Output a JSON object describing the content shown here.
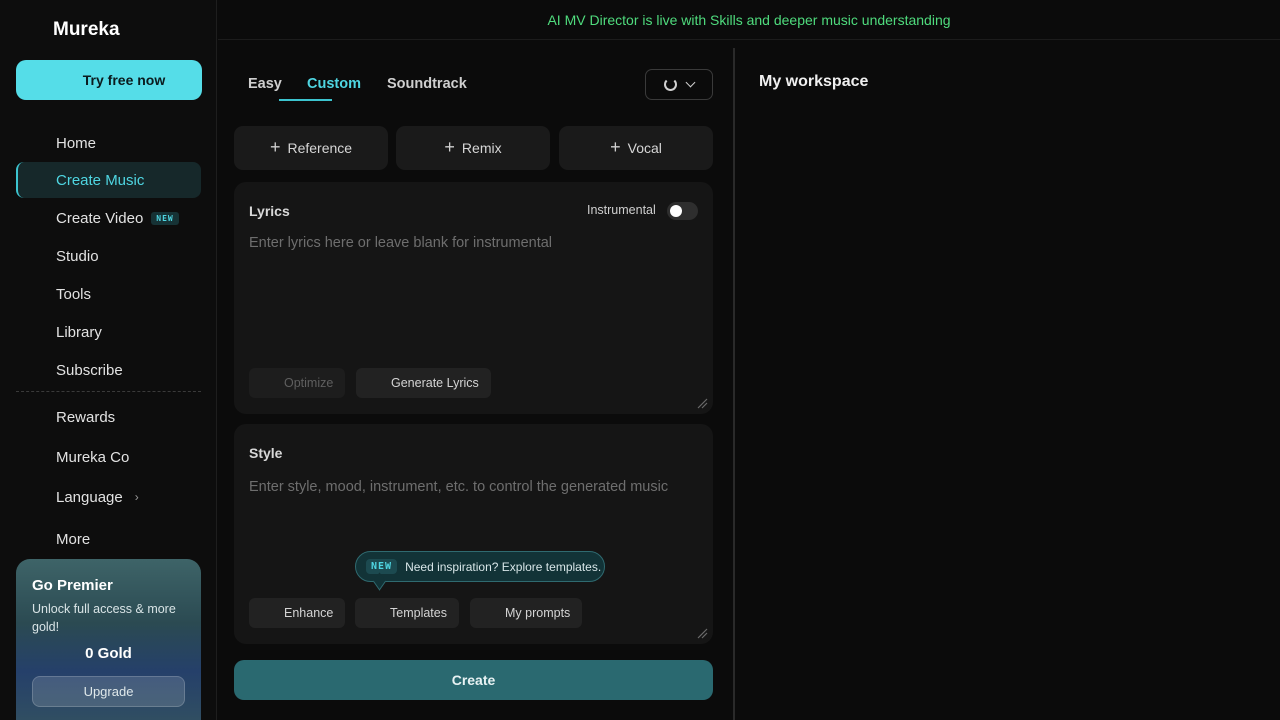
{
  "app": {
    "logo": "Mureka"
  },
  "sidebar": {
    "try_label": "Try free now",
    "items": [
      {
        "label": "Home"
      },
      {
        "label": "Create Music"
      },
      {
        "label": "Create Video",
        "badge": "NEW"
      },
      {
        "label": "Studio"
      },
      {
        "label": "Tools"
      },
      {
        "label": "Library"
      },
      {
        "label": "Subscribe"
      }
    ],
    "secondary": [
      {
        "label": "Rewards"
      },
      {
        "label": "Mureka Co"
      },
      {
        "label": "Language"
      },
      {
        "label": "More"
      }
    ],
    "premier": {
      "title": "Go Premier",
      "subtitle": "Unlock full access & more gold!",
      "gold": "0 Gold",
      "upgrade_label": "Upgrade"
    }
  },
  "banner": {
    "text": "AI MV Director is live with Skills and deeper music understanding"
  },
  "main": {
    "tabs": [
      {
        "label": "Easy"
      },
      {
        "label": "Custom"
      },
      {
        "label": "Soundtrack"
      }
    ],
    "active_tab": "Custom",
    "pills": [
      {
        "label": "Reference"
      },
      {
        "label": "Remix"
      },
      {
        "label": "Vocal"
      }
    ],
    "lyrics": {
      "label": "Lyrics",
      "instrumental_label": "Instrumental",
      "instrumental_on": false,
      "placeholder": "Enter lyrics here or leave blank for instrumental",
      "optimize_label": "Optimize",
      "generate_label": "Generate Lyrics"
    },
    "style": {
      "label": "Style",
      "placeholder": "Enter style, mood, instrument, etc. to control the generated music",
      "tooltip_badge": "NEW",
      "tooltip_text": "Need inspiration? Explore templates.",
      "enhance_label": "Enhance",
      "templates_label": "Templates",
      "prompts_label": "My prompts"
    },
    "create_label": "Create"
  },
  "workspace": {
    "title": "My workspace"
  },
  "colors": {
    "accent": "#4fd6e2",
    "banner_green": "#4fdb7d",
    "create_bg": "#2a6970"
  }
}
